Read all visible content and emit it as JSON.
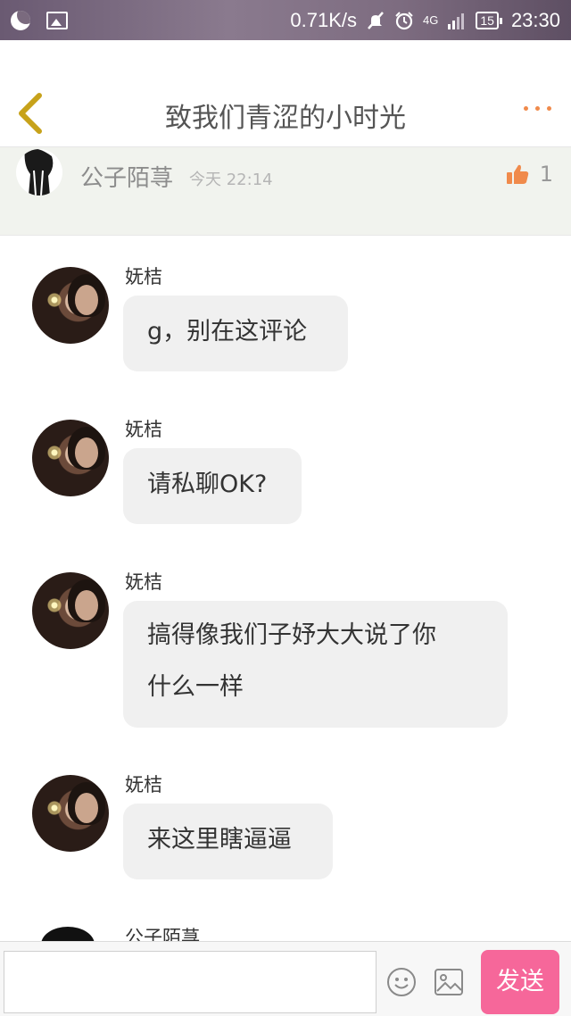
{
  "status_bar": {
    "speed": "0.71K/s",
    "network": "4G",
    "battery": "15",
    "time": "23:30"
  },
  "header": {
    "title": "致我们青涩的小时光"
  },
  "post": {
    "author": "公子陌荨",
    "time": "今天 22:14",
    "likes": "1"
  },
  "messages": [
    {
      "sender": "妩桔",
      "lines": [
        "g，别在这评论"
      ]
    },
    {
      "sender": "妩桔",
      "lines": [
        "请私聊OK?"
      ]
    },
    {
      "sender": "妩桔",
      "lines": [
        "搞得像我们子妤大大说了你",
        "什么一样"
      ]
    },
    {
      "sender": "妩桔",
      "lines": [
        "来这里瞎逼逼"
      ]
    },
    {
      "sender": "公子陌荨",
      "lines": []
    }
  ],
  "input": {
    "placeholder": "",
    "send_label": "发送"
  },
  "colors": {
    "accent_orange": "#f08a4b",
    "send_pink": "#f6679a",
    "bubble_bg": "#f0f0f0"
  }
}
